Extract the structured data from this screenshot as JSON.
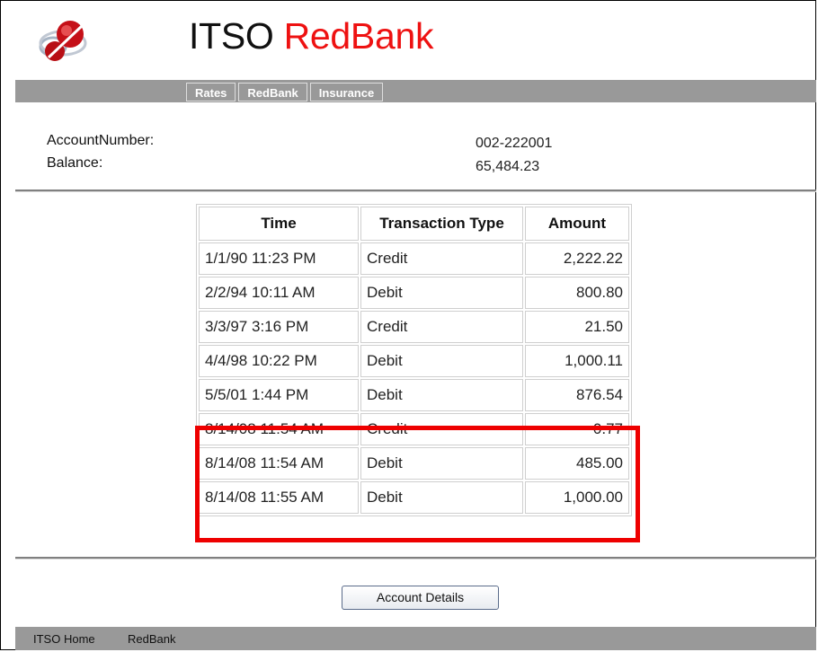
{
  "header": {
    "brand_prefix": "ITSO",
    "brand_suffix": "RedBank"
  },
  "nav": {
    "tabs": [
      "Rates",
      "RedBank",
      "Insurance"
    ]
  },
  "account": {
    "number_label": "AccountNumber:",
    "number_value": "002-222001",
    "balance_label": "Balance:",
    "balance_value": "65,484.23"
  },
  "table": {
    "headers": [
      "Time",
      "Transaction Type",
      "Amount"
    ],
    "rows": [
      [
        "1/1/90 11:23 PM",
        "Credit",
        "2,222.22"
      ],
      [
        "2/2/94 10:11 AM",
        "Debit",
        "800.80"
      ],
      [
        "3/3/97 3:16 PM",
        "Credit",
        "21.50"
      ],
      [
        "4/4/98 10:22 PM",
        "Debit",
        "1,000.11"
      ],
      [
        "5/5/01 1:44 PM",
        "Debit",
        "876.54"
      ],
      [
        "8/14/08 11:54 AM",
        "Credit",
        "0.77"
      ],
      [
        "8/14/08 11:54 AM",
        "Debit",
        "485.00"
      ],
      [
        "8/14/08 11:55 AM",
        "Debit",
        "1,000.00"
      ]
    ]
  },
  "actions": {
    "details_label": "Account Details"
  },
  "footer": {
    "links": [
      "ITSO Home",
      "RedBank"
    ]
  },
  "colors": {
    "accent": "#ee1111",
    "nav_bg": "#999999",
    "highlight": "#ee0000"
  }
}
